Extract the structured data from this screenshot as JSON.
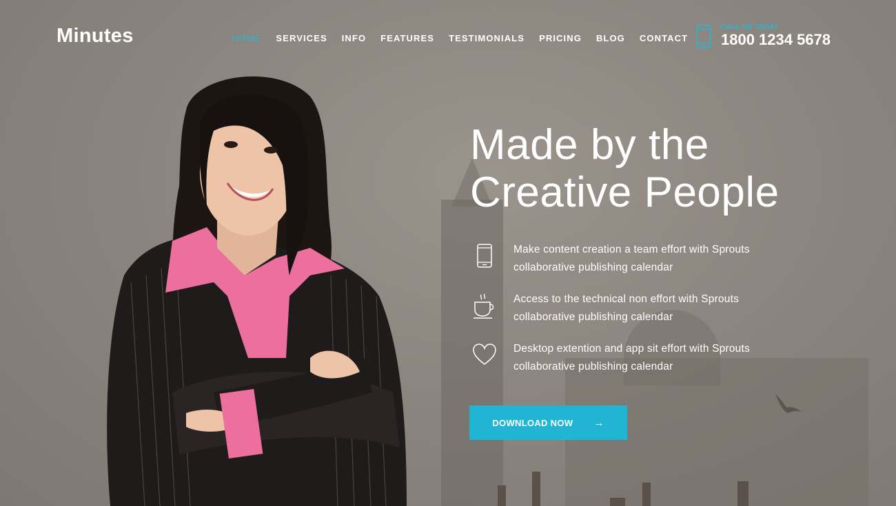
{
  "brand": {
    "logo": "Minutes"
  },
  "nav": {
    "items": [
      {
        "label": "HOME",
        "active": true
      },
      {
        "label": "SERVICES",
        "active": false
      },
      {
        "label": "INFO",
        "active": false
      },
      {
        "label": "FEATURES",
        "active": false
      },
      {
        "label": "TESTIMONIALS",
        "active": false
      },
      {
        "label": "PRICING",
        "active": false
      },
      {
        "label": "BLOG",
        "active": false
      },
      {
        "label": "CONTACT",
        "active": false
      }
    ]
  },
  "contact": {
    "label": "CALL US TODAY",
    "phone": "1800 1234 5678",
    "icon": "mobile-phone-icon"
  },
  "hero": {
    "headline_line1": "Made by the",
    "headline_line2": "Creative People",
    "features": [
      {
        "icon": "mobile-phone-icon",
        "line1": "Make content creation a team effort with Sprouts",
        "line2": "collaborative publishing calendar"
      },
      {
        "icon": "coffee-cup-icon",
        "line1": "Access to the technical non effort with Sprouts",
        "line2": "collaborative publishing calendar"
      },
      {
        "icon": "heart-icon",
        "line1": "Desktop extention and app sit effort with Sprouts",
        "line2": "collaborative publishing calendar"
      }
    ],
    "cta_label": "DOWNLOAD NOW",
    "cta_icon": "arrow-right-icon"
  },
  "colors": {
    "accent": "#21b5d4",
    "text": "#ffffff",
    "background": "#8c8680"
  }
}
